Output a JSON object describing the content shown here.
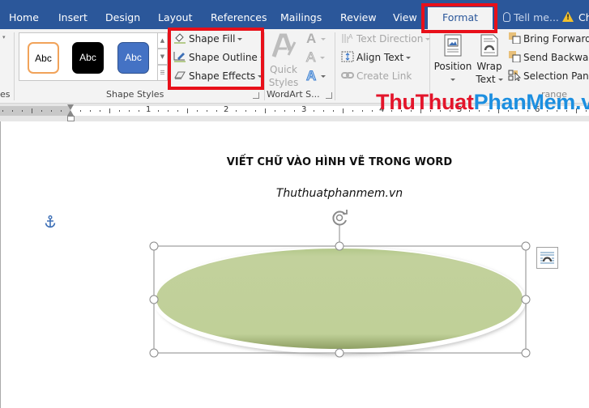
{
  "tabs": {
    "home": "Home",
    "insert": "Insert",
    "design": "Design",
    "layout": "Layout",
    "references": "References",
    "mailings": "Mailings",
    "review": "Review",
    "view": "View",
    "format": "Format",
    "active": "Format",
    "tell_me": "Tell me...",
    "share_truncated": "Ch"
  },
  "ribbon": {
    "left_group_label_truncated": "es",
    "shape_styles": {
      "label": "Shape Styles",
      "gallery": [
        {
          "text": "Abc",
          "style": "white-fill-orange-outline"
        },
        {
          "text": "Abc",
          "style": "black-fill"
        },
        {
          "text": "Abc",
          "style": "blue-fill"
        }
      ],
      "shape_fill": "Shape Fill",
      "shape_outline": "Shape Outline",
      "shape_effects": "Shape Effects"
    },
    "wordart": {
      "label": "WordArt S...",
      "quick_styles_line1": "Quick",
      "quick_styles_line2": "Styles"
    },
    "text": {
      "text_direction": "Text Direction",
      "align_text": "Align Text",
      "create_link": "Create Link"
    },
    "arrange": {
      "position": "Position",
      "wrap_line1": "Wrap",
      "wrap_line2": "Text",
      "bring_forward": "Bring Forward",
      "send_backward": "Send Backward",
      "selection_pane": "Selection Pane",
      "label_partial": "range"
    }
  },
  "watermark": {
    "part_red": "ThuThuat",
    "part_blue": "PhanMem.vn"
  },
  "ruler": {
    "numbers": [
      "1",
      "2",
      "3",
      "4",
      "5",
      "6"
    ]
  },
  "document": {
    "title": "VIẾT CHỮ VÀO HÌNH VẼ TRONG WORD",
    "subtitle": "Thuthuatphanmem.vn",
    "shape": {
      "type": "ellipse",
      "fill_color": "#c0d098",
      "selected": true
    }
  },
  "colors": {
    "tab_bar": "#2b579a",
    "highlight": "#e8101a",
    "ribbon_bg": "#f3f3f3"
  }
}
